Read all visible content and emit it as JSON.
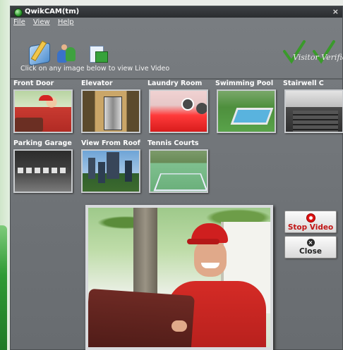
{
  "window": {
    "title": "QwikCAM(tm)",
    "close_glyph": "×"
  },
  "menu": [
    "File",
    "View",
    "Help"
  ],
  "toolbar": {
    "icons": [
      "edit-icon",
      "users-icon",
      "monitor-icon"
    ],
    "instruction": "Click on any image below to view Live Video"
  },
  "logo": {
    "text": "Visitor Verifier"
  },
  "cameras": [
    {
      "label": "Front Door"
    },
    {
      "label": "Elevator"
    },
    {
      "label": "Laundry Room"
    },
    {
      "label": "Swimming Pool"
    },
    {
      "label": "Stairwell C"
    },
    {
      "label": "Parking Garage"
    },
    {
      "label": "View From Roof"
    },
    {
      "label": "Tennis Courts"
    }
  ],
  "buttons": {
    "stop": "Stop Video",
    "close": "Close"
  },
  "colors": {
    "window_bg": "#6e7276",
    "stop_text": "#c21616",
    "logo_check": "#3a9a2b"
  }
}
